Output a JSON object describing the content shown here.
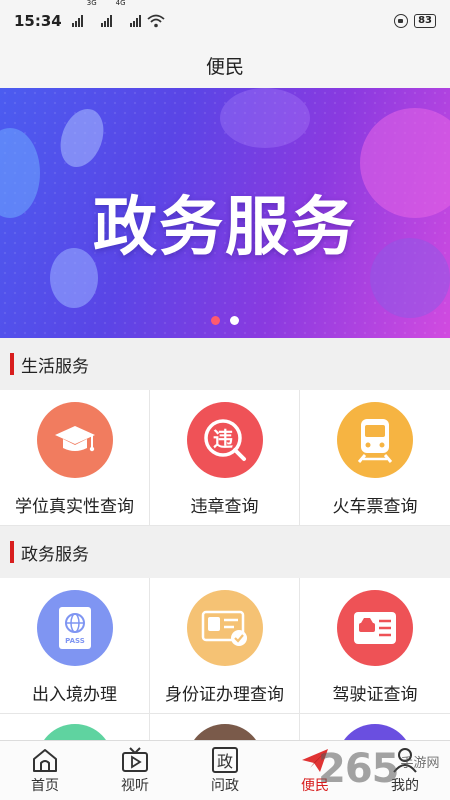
{
  "status_bar": {
    "time": "15:34",
    "sim1_label": "3G",
    "sim2_label": "4G",
    "battery": "83"
  },
  "header": {
    "title": "便民"
  },
  "banner": {
    "title": "政务服务",
    "slide_count": 2,
    "active_slide": 1
  },
  "sections": [
    {
      "title": "生活服务",
      "items": [
        {
          "label": "学位真实性查询",
          "icon": "graduation-cap-icon",
          "color": "#f17c5f"
        },
        {
          "label": "违章查询",
          "icon": "traffic-violation-icon",
          "color": "#ef5257"
        },
        {
          "label": "火车票查询",
          "icon": "train-icon",
          "color": "#f6b442"
        }
      ]
    },
    {
      "title": "政务服务",
      "items": [
        {
          "label": "出入境办理",
          "icon": "passport-icon",
          "color": "#7f95f2"
        },
        {
          "label": "身份证办理查询",
          "icon": "id-card-icon",
          "color": "#f5c274"
        },
        {
          "label": "驾驶证查询",
          "icon": "driver-license-icon",
          "color": "#ee5256"
        }
      ]
    }
  ],
  "partial_row_colors": [
    "#5fd3a0",
    "#7a5a4a",
    "#6a4fe0"
  ],
  "bottom_nav": [
    {
      "label": "首页",
      "icon": "home-icon"
    },
    {
      "label": "视听",
      "icon": "tv-icon"
    },
    {
      "label": "问政",
      "icon": "politics-icon",
      "glyph": "政"
    },
    {
      "label": "便民",
      "icon": "paper-plane-icon",
      "active": true
    },
    {
      "label": "我的",
      "icon": "user-icon"
    }
  ],
  "watermark": {
    "number": "265",
    "text": "手游网"
  },
  "colors": {
    "accent": "#d81e1e",
    "section_bg": "#f0f0f0"
  }
}
